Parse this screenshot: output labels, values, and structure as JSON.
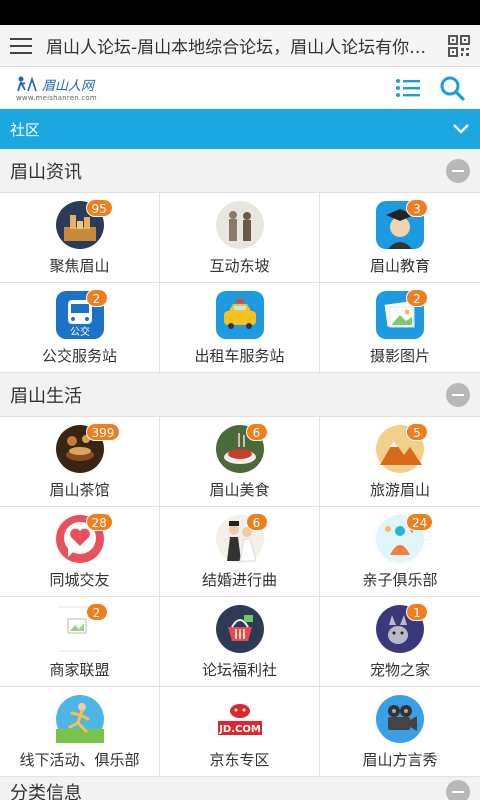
{
  "browser": {
    "url_title": "眉山人论坛-眉山本地综合论坛，眉山人论坛有你更精彩"
  },
  "site": {
    "logo_text": "眉山人网",
    "logo_url": "www.meishanren.com"
  },
  "community": {
    "label": "社区"
  },
  "sections": [
    {
      "title": "眉山资讯",
      "items": [
        {
          "label": "聚焦眉山",
          "badge": "95",
          "icon": "city-night-icon",
          "color": "#c58a3a"
        },
        {
          "label": "互动东坡",
          "badge": "",
          "icon": "statues-icon",
          "color": "#8a7a68"
        },
        {
          "label": "眉山教育",
          "badge": "3",
          "icon": "graduate-icon",
          "color": "#1e9be0"
        },
        {
          "label": "公交服务站",
          "badge": "2",
          "icon": "bus-icon",
          "color": "#1b72c6"
        },
        {
          "label": "出租车服务站",
          "badge": "",
          "icon": "taxi-icon",
          "color": "#1e9be0"
        },
        {
          "label": "摄影图片",
          "badge": "2",
          "icon": "photo-icon",
          "color": "#1e9be0"
        }
      ]
    },
    {
      "title": "眉山生活",
      "items": [
        {
          "label": "眉山茶馆",
          "badge": "399",
          "icon": "tea-icon",
          "color": "#8a4a22"
        },
        {
          "label": "眉山美食",
          "badge": "6",
          "icon": "food-icon",
          "color": "#c8402a"
        },
        {
          "label": "旅游眉山",
          "badge": "5",
          "icon": "mountain-icon",
          "color": "#d46a1a"
        },
        {
          "label": "同城交友",
          "badge": "28",
          "icon": "heart-chat-icon",
          "color": "#e8505b"
        },
        {
          "label": "结婚进行曲",
          "badge": "6",
          "icon": "wedding-icon",
          "color": "#b08a6a"
        },
        {
          "label": "亲子俱乐部",
          "badge": "24",
          "icon": "family-icon",
          "color": "#2bb3e0"
        },
        {
          "label": "商家联盟",
          "badge": "2",
          "icon": "broken-image-icon",
          "color": "#ffffff"
        },
        {
          "label": "论坛福利社",
          "badge": "",
          "icon": "basket-icon",
          "color": "#2d3b55"
        },
        {
          "label": "宠物之家",
          "badge": "1",
          "icon": "pet-icon",
          "color": "#3a3a7a"
        },
        {
          "label": "线下活动、俱乐部",
          "badge": "",
          "icon": "runner-icon",
          "color": "#4db6e6"
        },
        {
          "label": "京东专区",
          "badge": "",
          "icon": "jd-icon",
          "color": "#e0262b"
        },
        {
          "label": "眉山方言秀",
          "badge": "",
          "icon": "projector-icon",
          "color": "#3aa0e6"
        }
      ]
    },
    {
      "title": "分类信息",
      "items": []
    }
  ]
}
